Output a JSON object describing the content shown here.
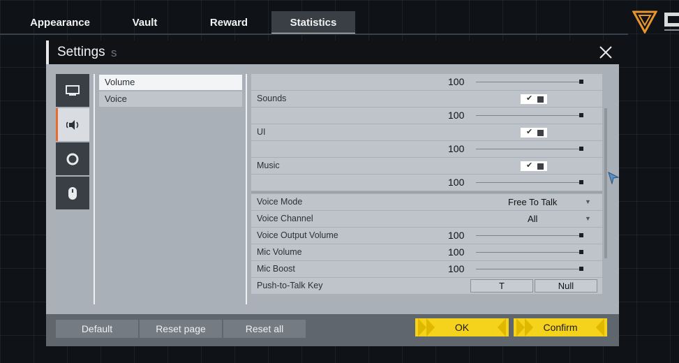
{
  "nav": {
    "tabs": [
      {
        "label": "Appearance"
      },
      {
        "label": "Vault"
      },
      {
        "label": "Reward"
      },
      {
        "label": "Statistics"
      }
    ],
    "active_tab": "Statistics",
    "accent_color": "#e86a2c"
  },
  "settings": {
    "title": "Settings",
    "title_ghost": "s",
    "categories": [
      {
        "icon": "monitor-icon"
      },
      {
        "icon": "speaker-icon"
      },
      {
        "icon": "network-icon"
      },
      {
        "icon": "mouse-icon"
      }
    ],
    "subcategories": [
      {
        "label": "Volume"
      },
      {
        "label": "Voice"
      }
    ],
    "volume_rows": {
      "master_value": "100",
      "sounds_label": "Sounds",
      "sounds_value": "100",
      "ui_label": "UI",
      "ui_value": "100",
      "music_label": "Music",
      "music_value": "100",
      "checkbox_tick": "✔"
    },
    "voice_rows": {
      "mode_label": "Voice Mode",
      "mode_value": "Free To Talk",
      "channel_label": "Voice Channel",
      "channel_value": "All",
      "output_label": "Voice Output Volume",
      "output_value": "100",
      "mic_label": "Mic Volume",
      "mic_value": "100",
      "boost_label": "Mic Boost",
      "boost_value": "100",
      "ptt_label": "Push-to-Talk Key",
      "ptt_key1": "T",
      "ptt_key2": "Null"
    },
    "slider_level": 1.0,
    "footer": {
      "default_label": "Default",
      "reset_page_label": "Reset page",
      "reset_all_label": "Reset all",
      "ok_label": "OK",
      "confirm_label": "Confirm",
      "button_color": "#f5d21b"
    }
  }
}
